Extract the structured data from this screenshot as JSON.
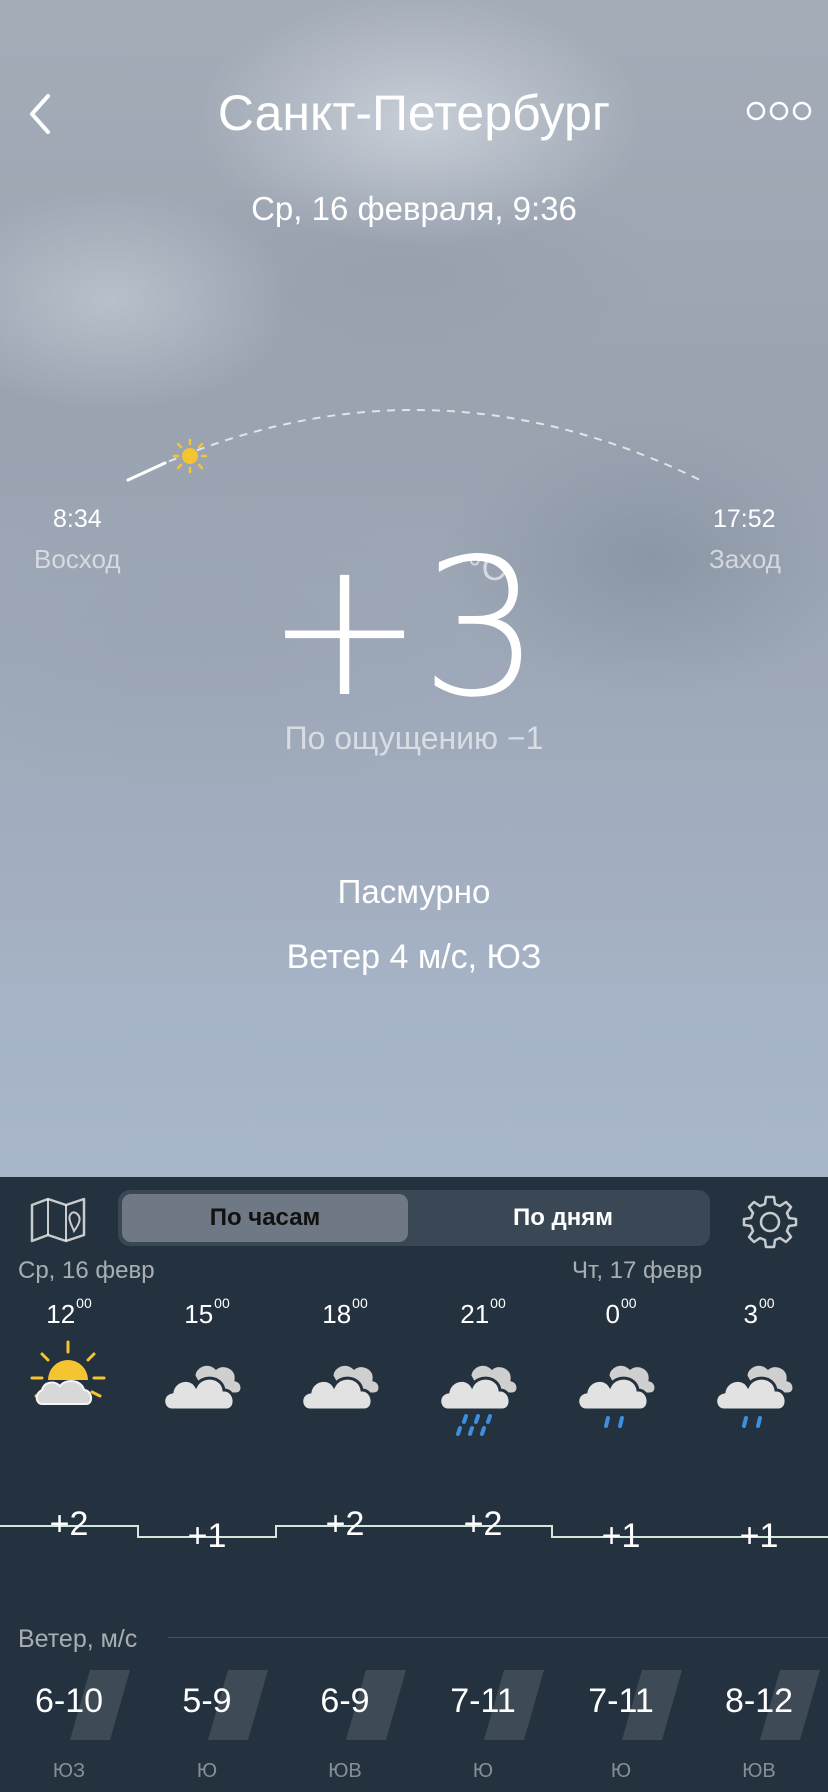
{
  "header": {
    "title": "Санкт-Петербург",
    "date": "Ср, 16 февраля, 9:36"
  },
  "sun": {
    "sunrise_time": "8:34",
    "sunrise_label": "Восход",
    "sunset_time": "17:52",
    "sunset_label": "Заход",
    "progress": 0.07
  },
  "current": {
    "temp": "+3",
    "unit": "°C",
    "feels_like": "По ощущению −1",
    "condition": "Пасмурно",
    "wind": "Ветер 4 м/с, ЮЗ"
  },
  "tabs": {
    "hourly": "По часам",
    "daily": "По дням",
    "active": "hourly"
  },
  "forecast": {
    "days": [
      "Ср, 16 февр",
      "Чт, 17 февр"
    ],
    "hours": [
      {
        "h": "12",
        "m": "00",
        "icon": "sun-cloud-icon",
        "temp": "+2",
        "wind": "6-10",
        "dir": "ЮЗ"
      },
      {
        "h": "15",
        "m": "00",
        "icon": "cloud-icon",
        "temp": "+1",
        "wind": "5-9",
        "dir": "Ю"
      },
      {
        "h": "18",
        "m": "00",
        "icon": "cloud-icon",
        "temp": "+2",
        "wind": "6-9",
        "dir": "ЮВ"
      },
      {
        "h": "21",
        "m": "00",
        "icon": "cloud-rain-heavy-icon",
        "temp": "+2",
        "wind": "7-11",
        "dir": "Ю"
      },
      {
        "h": "0",
        "m": "00",
        "icon": "cloud-rain-icon",
        "temp": "+1",
        "wind": "7-11",
        "dir": "Ю"
      },
      {
        "h": "3",
        "m": "00",
        "icon": "cloud-rain-icon",
        "temp": "+1",
        "wind": "8-12",
        "dir": "ЮВ"
      }
    ],
    "wind_title": "Ветер, м/с"
  },
  "colors": {
    "panel": "#24323f",
    "accent_line": "#cfe8d8",
    "rain": "#3d8fe0",
    "sun": "#f5c431"
  }
}
